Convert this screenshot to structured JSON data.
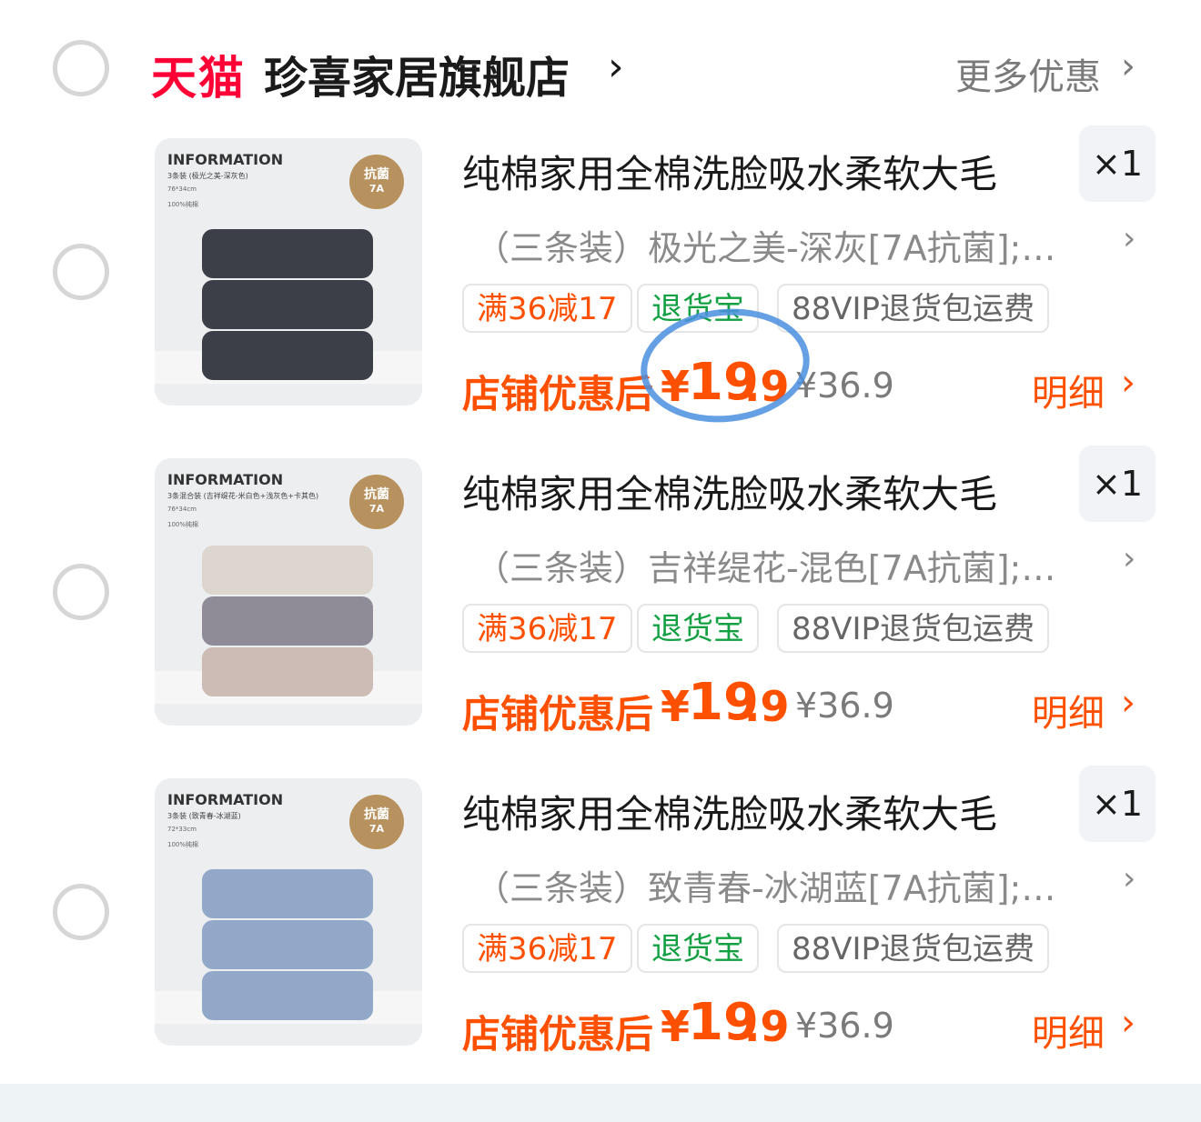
{
  "store": {
    "logo_text": "天猫",
    "name": "珍喜家居旗舰店",
    "more_label": "更多优惠"
  },
  "items": [
    {
      "thumb": {
        "info": "INFORMATION",
        "pack": "3条装 (极光之美-深灰色)",
        "size": "76*34cm",
        "material": "100%纯棉",
        "badge": "抗菌",
        "badge_sub": "7A"
      },
      "title": "纯棉家用全棉洗脸吸水柔软大毛",
      "qty": "×1",
      "sku": "（三条装）极光之美-深灰[7A抗菌];…",
      "tags": [
        "满36减17",
        "退货宝",
        "88VIP退货包运费"
      ],
      "price_label": "店铺优惠后",
      "price_currency": "¥",
      "price_int": "19",
      "price_dec": ".9",
      "original_price": "¥36.9",
      "detail_label": "明细",
      "towel_color": "#3d3f48"
    },
    {
      "thumb": {
        "info": "INFORMATION",
        "pack": "3条混合装 (吉祥缇花-米白色+浅灰色+卡其色)",
        "size": "76*34cm",
        "material": "100%纯棉",
        "badge": "抗菌",
        "badge_sub": "7A"
      },
      "title": "纯棉家用全棉洗脸吸水柔软大毛",
      "qty": "×1",
      "sku": "（三条装）吉祥缇花-混色[7A抗菌];…",
      "tags": [
        "满36减17",
        "退货宝",
        "88VIP退货包运费"
      ],
      "price_label": "店铺优惠后",
      "price_currency": "¥",
      "price_int": "19",
      "price_dec": ".9",
      "original_price": "¥36.9",
      "detail_label": "明细",
      "towel_colors": [
        "#ddd6ce",
        "#8f8c98",
        "#cdbbb6"
      ]
    },
    {
      "thumb": {
        "info": "INFORMATION",
        "pack": "3条装 (致青春-冰湖蓝)",
        "size": "72*33cm",
        "material": "100%纯棉",
        "badge": "抗菌",
        "badge_sub": "7A"
      },
      "title": "纯棉家用全棉洗脸吸水柔软大毛",
      "qty": "×1",
      "sku": "（三条装）致青春-冰湖蓝[7A抗菌];…",
      "tags": [
        "满36减17",
        "退货宝",
        "88VIP退货包运费"
      ],
      "price_label": "店铺优惠后",
      "price_currency": "¥",
      "price_int": "19",
      "price_dec": ".9",
      "original_price": "¥36.9",
      "detail_label": "明细",
      "towel_color": "#93a8c9"
    }
  ],
  "colors": {
    "tmall_red": "#ff0036",
    "price_orange": "#ff5000",
    "tag_green": "#12a042",
    "annotation_blue": "#4a8fe0"
  }
}
